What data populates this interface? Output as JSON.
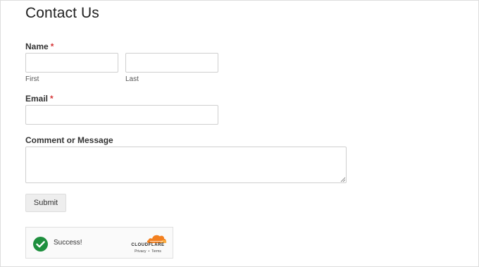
{
  "form": {
    "title": "Contact Us",
    "required_marker": "*",
    "name": {
      "label": "Name",
      "first_sublabel": "First",
      "last_sublabel": "Last",
      "first_value": "",
      "last_value": ""
    },
    "email": {
      "label": "Email",
      "value": ""
    },
    "message": {
      "label": "Comment or Message",
      "value": ""
    },
    "submit_label": "Submit"
  },
  "captcha": {
    "status_text": "Success!",
    "brand": "CLOUDFLARE",
    "privacy_link": "Privacy",
    "separator": "•",
    "terms_link": "Terms",
    "colors": {
      "check_green": "#1E8F3E",
      "cloud_orange": "#F38020",
      "cloud_light": "#FBAD41"
    }
  },
  "colors": {
    "required": "#D63637",
    "button_bg": "#EEEEEE"
  }
}
